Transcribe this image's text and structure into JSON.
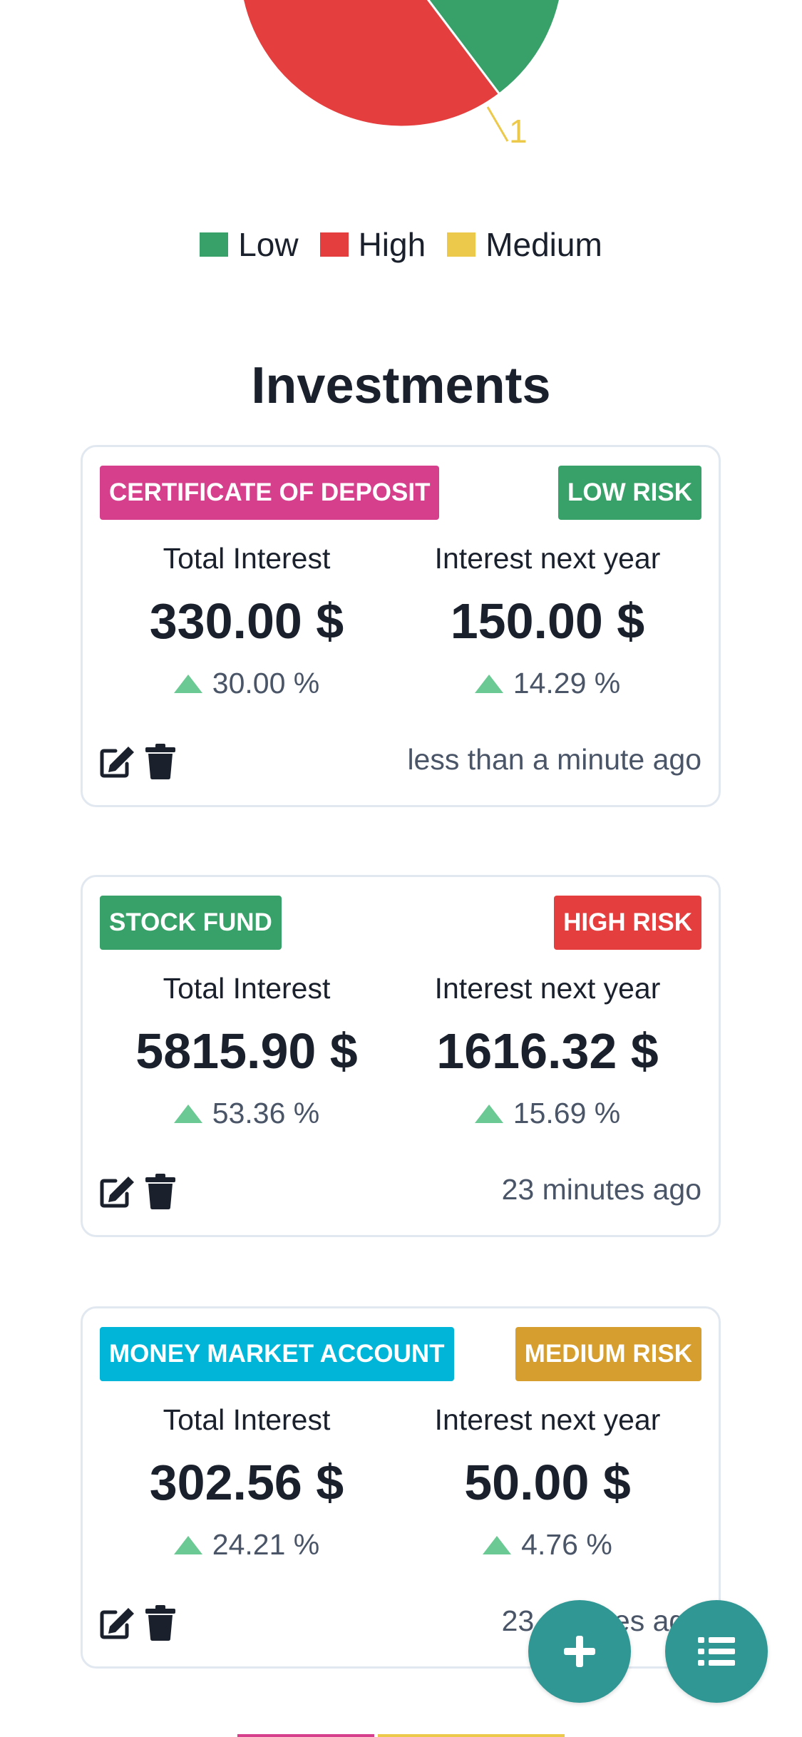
{
  "chart_data": {
    "type": "pie",
    "categories": [
      "Low",
      "High",
      "Medium"
    ],
    "values": [
      1,
      1,
      1
    ],
    "colors": [
      "#38a169",
      "#e53e3e",
      "#ecc94b"
    ],
    "visible_data_labels": [
      "1"
    ],
    "legend": "bottom-center"
  },
  "legend": [
    {
      "label": "Low",
      "color": "#38a169"
    },
    {
      "label": "High",
      "color": "#e53e3e"
    },
    {
      "label": "Medium",
      "color": "#ecc94b"
    }
  ],
  "section_title": "Investments",
  "labels": {
    "total_interest": "Total Interest",
    "interest_next_year": "Interest next year"
  },
  "investments": [
    {
      "type": "CERTIFICATE OF DEPOSIT",
      "type_color": "#d53f8c",
      "risk": "LOW RISK",
      "risk_color": "#38a169",
      "total_interest": "330.00 $",
      "total_change": "30.00 %",
      "next_year_interest": "150.00 $",
      "next_year_change": "14.29 %",
      "updated": "less than a minute ago"
    },
    {
      "type": "STOCK FUND",
      "type_color": "#38a169",
      "risk": "HIGH RISK",
      "risk_color": "#e53e3e",
      "total_interest": "5815.90 $",
      "total_change": "53.36 %",
      "next_year_interest": "1616.32 $",
      "next_year_change": "15.69 %",
      "updated": "23 minutes ago"
    },
    {
      "type": "MONEY MARKET ACCOUNT",
      "type_color": "#00b5d8",
      "risk": "MEDIUM RISK",
      "risk_color": "#d69e2e",
      "total_interest": "302.56 $",
      "total_change": "24.21 %",
      "next_year_interest": "50.00 $",
      "next_year_change": "4.76 %",
      "updated": "23 minutes ago"
    }
  ],
  "fab": {
    "add_icon": "plus-icon",
    "list_icon": "list-icon",
    "color": "#319795"
  }
}
